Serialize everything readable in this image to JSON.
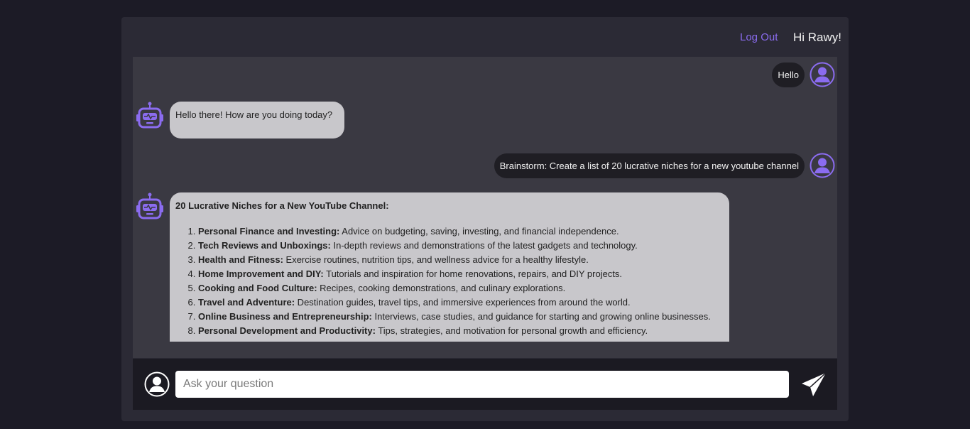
{
  "header": {
    "logout_label": "Log Out",
    "greeting": "Hi Rawy!"
  },
  "colors": {
    "accent": "#8b6cf0",
    "background": "#1c1b26",
    "panel": "#2b2a35",
    "chat_area": "#3a3942",
    "bot_bubble": "#c8c7cb",
    "user_bubble": "#1f1e24"
  },
  "messages": [
    {
      "sender": "user",
      "text": "Hello",
      "icon": "user-avatar-icon"
    },
    {
      "sender": "bot",
      "text": "Hello there! How are you doing today?",
      "icon": "robot-avatar-icon"
    },
    {
      "sender": "user",
      "text": "Brainstorm: Create a list of 20 lucrative niches for a new youtube channel",
      "icon": "user-avatar-icon"
    },
    {
      "sender": "bot",
      "icon": "robot-avatar-icon",
      "heading": "20 Lucrative Niches for a New YouTube Channel:",
      "items": [
        {
          "title": "Personal Finance and Investing:",
          "text": " Advice on budgeting, saving, investing, and financial independence."
        },
        {
          "title": "Tech Reviews and Unboxings:",
          "text": " In-depth reviews and demonstrations of the latest gadgets and technology."
        },
        {
          "title": "Health and Fitness:",
          "text": " Exercise routines, nutrition tips, and wellness advice for a healthy lifestyle."
        },
        {
          "title": "Home Improvement and DIY:",
          "text": " Tutorials and inspiration for home renovations, repairs, and DIY projects."
        },
        {
          "title": "Cooking and Food Culture:",
          "text": " Recipes, cooking demonstrations, and culinary explorations."
        },
        {
          "title": "Travel and Adventure:",
          "text": " Destination guides, travel tips, and immersive experiences from around the world."
        },
        {
          "title": "Online Business and Entrepreneurship:",
          "text": " Interviews, case studies, and guidance for starting and growing online businesses."
        },
        {
          "title": "Personal Development and Productivity:",
          "text": " Tips, strategies, and motivation for personal growth and efficiency."
        }
      ]
    }
  ],
  "input": {
    "placeholder": "Ask your question",
    "value": "",
    "avatar_icon": "user-avatar-icon",
    "send_icon": "send-icon"
  }
}
